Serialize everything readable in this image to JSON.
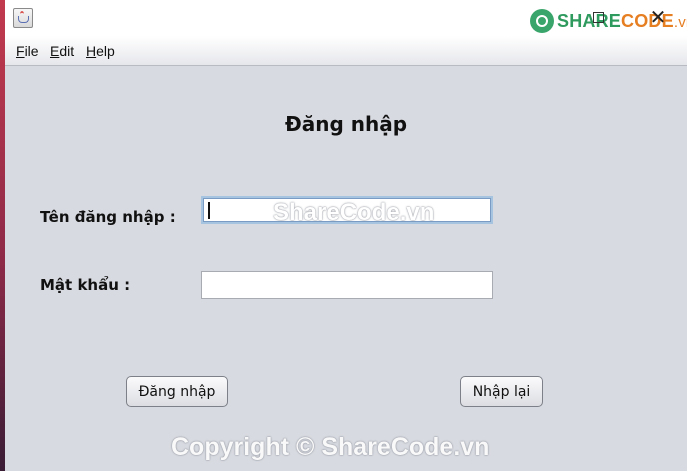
{
  "window": {
    "brand": {
      "share": "SHARE",
      "code": "CODE",
      "vn": ".vn"
    },
    "close_symbol": "✕"
  },
  "menu": {
    "items": [
      {
        "mnemonic": "F",
        "rest": "ile"
      },
      {
        "mnemonic": "E",
        "rest": "dit"
      },
      {
        "mnemonic": "H",
        "rest": "elp"
      }
    ]
  },
  "form": {
    "title": "Đăng nhập",
    "username_label": "Tên đăng nhập :",
    "username_value": "",
    "password_label": "Mật khẩu :",
    "password_value": "",
    "login_button": "Đăng nhập",
    "reset_button": "Nhập lại"
  },
  "watermarks": {
    "field": "ShareCode.vn",
    "footer": "Copyright © ShareCode.vn"
  },
  "colors": {
    "form_background": "#d8dae1",
    "brand_green": "#2f9a5e",
    "brand_orange": "#e67e22",
    "focus_border": "#a6c3e0"
  }
}
